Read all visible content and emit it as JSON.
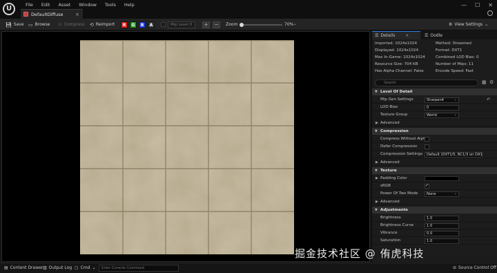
{
  "menu": [
    "File",
    "Edit",
    "Asset",
    "Window",
    "Tools",
    "Help"
  ],
  "document_tab": {
    "label": "DefaultDiffuse",
    "close": "×"
  },
  "window_controls": [
    "—",
    "☐",
    "✕"
  ],
  "toolbar": {
    "save": "Save",
    "browse": "Browse",
    "compress": "Compress",
    "reimport": "Reimport",
    "channels": [
      {
        "label": "R",
        "color": "#e02020"
      },
      {
        "label": "G",
        "color": "#20a020"
      },
      {
        "label": "B",
        "color": "#2040e0"
      },
      {
        "label": "A",
        "color": "#3a3a3a"
      }
    ],
    "mip_level": "Mip Level 0",
    "zoom_label": "Zoom",
    "zoom_value": "70%",
    "zoom_fraction": 0.0,
    "view_settings": "View Settings"
  },
  "panel_tabs": {
    "details": "Details",
    "oodle": "Oodle"
  },
  "info": {
    "imported": "Imported: 1024x1024",
    "method": "Method: Streamed",
    "displayed": "Displayed: 1024x1024",
    "format": "Format: DXT1",
    "max_in_game": "Max In-Game: 1024x1024",
    "combined_lod": "Combined LOD Bias: 0",
    "resource_size": "Resource Size: 704 KB",
    "num_mips": "Number of Mips: 11",
    "has_alpha": "Has Alpha Channel: False",
    "encode_speed": "Encode Speed: Fast"
  },
  "search_placeholder": "Search",
  "sections": {
    "level_of_detail": "Level Of Detail",
    "compression": "Compression",
    "texture": "Texture",
    "adjustments": "Adjustments",
    "advanced": "Advanced"
  },
  "props": {
    "mip_gen_label": "Mip Gen Settings",
    "mip_gen_value": "Sharpen4",
    "lod_bias_label": "LOD Bias",
    "lod_bias_value": "0",
    "texture_group_label": "Texture Group",
    "texture_group_value": "World",
    "compress_wo_alpha_label": "Compress Without Alpha",
    "defer_compression_label": "Defer Compression",
    "compression_settings_label": "Compression Settings",
    "compression_settings_value": "Default (DXT1/5, BC1/3 on DX11)",
    "padding_color_label": "Padding Color",
    "srgb_label": "sRGB",
    "power_of_two_label": "Power Of Two Mode",
    "power_of_two_value": "None",
    "brightness_label": "Brightness",
    "brightness_value": "1.0",
    "brightness_curve_label": "Brightness Curve",
    "brightness_curve_value": "1.0",
    "vibrance_label": "Vibrance",
    "vibrance_value": "0.0",
    "saturation_label": "Saturation",
    "saturation_value": "1.0"
  },
  "status": {
    "content_drawer": "Content Drawer",
    "output_log": "Output Log",
    "cmd": "Cmd",
    "console_placeholder": "Enter Console Command",
    "source_control": "Source Control Off"
  },
  "watermark": "掘金技术社区 @ 侑虎科技"
}
